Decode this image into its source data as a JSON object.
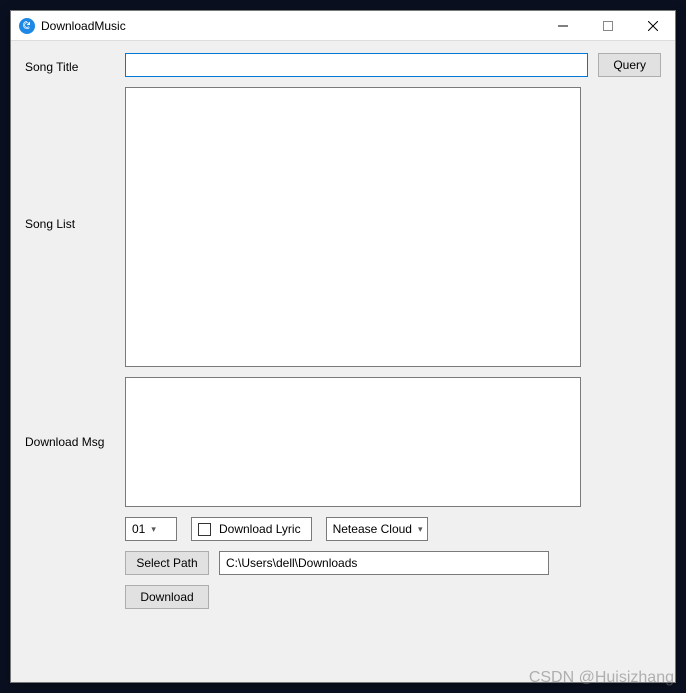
{
  "window": {
    "title": "DownloadMusic"
  },
  "labels": {
    "song_title": "Song Title",
    "song_list": "Song List",
    "download_msg": "Download Msg"
  },
  "inputs": {
    "song_title_value": "",
    "path_value": "C:\\Users\\dell\\Downloads"
  },
  "buttons": {
    "query": "Query",
    "select_path": "Select Path",
    "download": "Download"
  },
  "checkbox": {
    "download_lyric_label": "Download Lyric",
    "download_lyric_checked": false
  },
  "combos": {
    "count_selected": "01",
    "source_selected": "Netease Cloud"
  },
  "lists": {
    "song_list_items": [],
    "download_msg_items": []
  },
  "watermark": "CSDN @Huisizhang"
}
